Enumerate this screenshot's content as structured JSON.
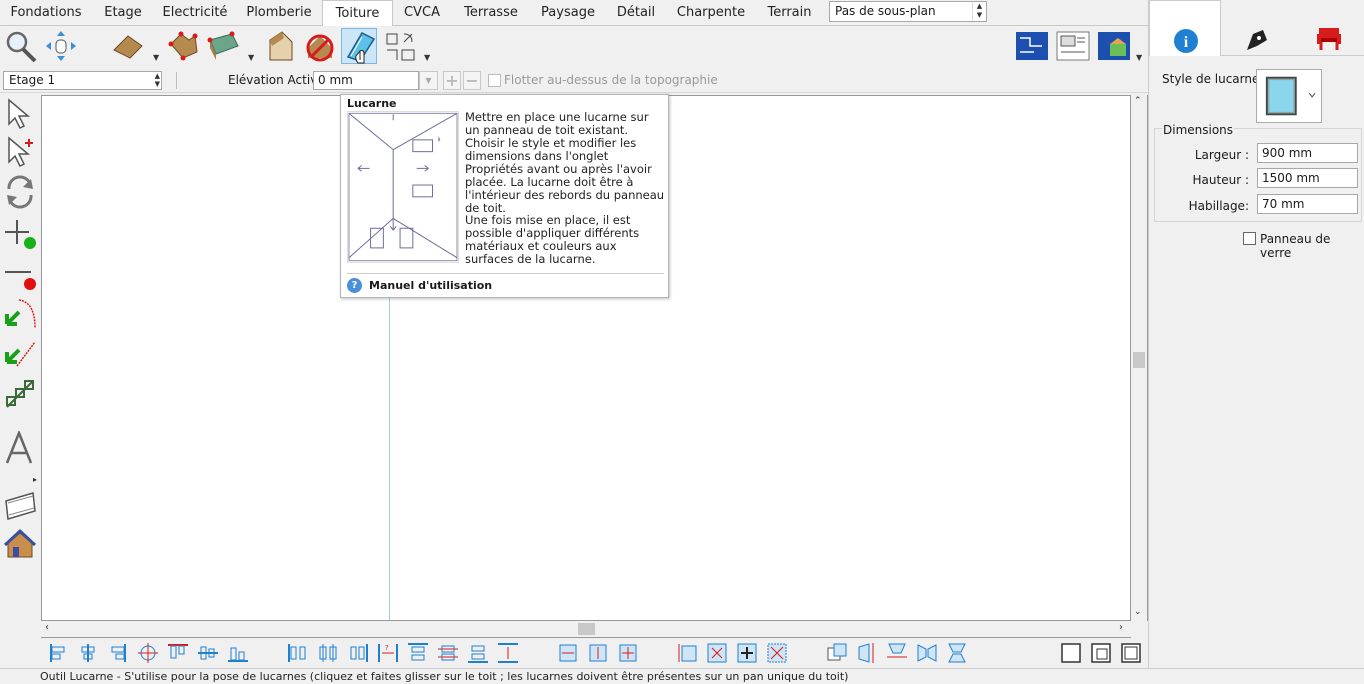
{
  "tabs": [
    "Fondations",
    "Etage",
    "Electricité",
    "Plomberie",
    "Toiture",
    "CVCA",
    "Terrasse",
    "Paysage",
    "Détail",
    "Charpente",
    "Terrain"
  ],
  "active_tab": "Toiture",
  "subplan_select": "Pas de sous-plan",
  "floor_select": "Etage 1",
  "elevation": {
    "label": "Elévation Active:",
    "value": "0 mm"
  },
  "float_topo_label": "Flotter au-dessus de la topographie",
  "tooltip": {
    "title": "Lucarne",
    "para1": "Mettre en place une lucarne sur un panneau de toit existant. Choisir le style et modifier les dimensions dans l'onglet Propriétés avant ou après l'avoir placée. La lucarne doit être à l'intérieur des rebords du panneau de toit.",
    "para2": "Une fois mise en place, il est possible d'appliquer différents matériaux et couleurs aux surfaces de la lucarne.",
    "manual": "Manuel d'utilisation"
  },
  "right_panel": {
    "style_label": "Style de lucarne :",
    "dimensions_title": "Dimensions",
    "width_label": "Largeur :",
    "width_value": "900 mm",
    "height_label": "Hauteur :",
    "height_value": "1500 mm",
    "trim_label": "Habillage:",
    "trim_value": "70 mm",
    "glass_label": "Panneau de verre"
  },
  "status_text": "Outil Lucarne - S'utilise pour la pose de lucarnes (cliquez et faites glisser sur le toit ; les lucarnes doivent être présentes sur un pan unique du toit)",
  "colors": {
    "accent_blue": "#1f7fd1",
    "canvas_line": "#9ecbe5",
    "red_marker": "#e01010",
    "green_marker": "#18b018"
  }
}
